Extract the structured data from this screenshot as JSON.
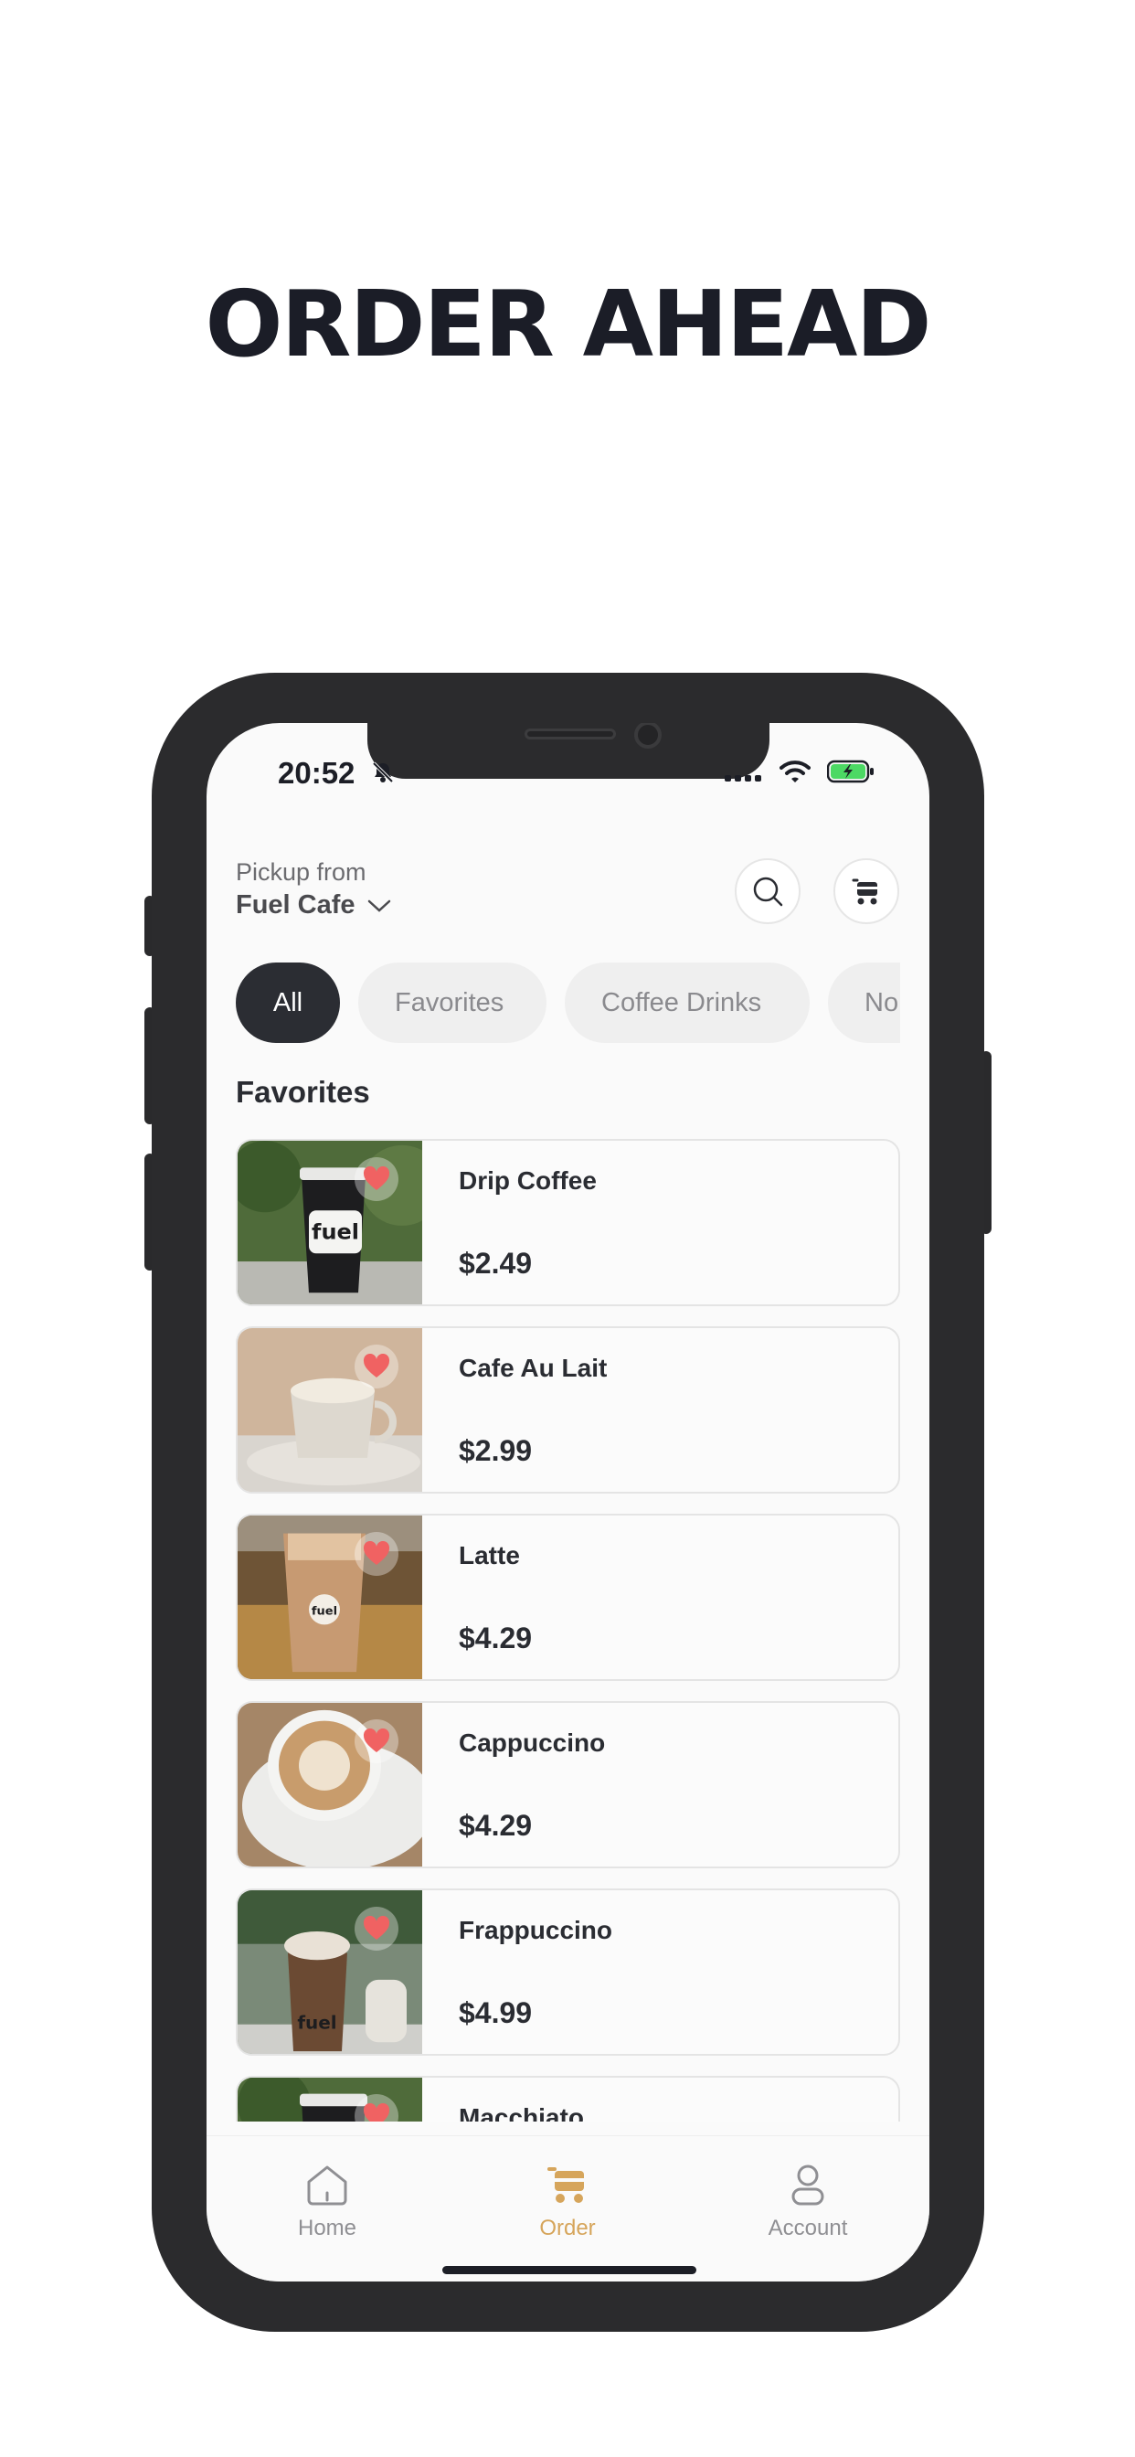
{
  "headline": "ORDER AHEAD",
  "status_bar": {
    "time": "20:52",
    "icons": [
      "bell-slash-icon",
      "cellular-signal-icon",
      "wifi-icon",
      "battery-charging-icon"
    ]
  },
  "header": {
    "pickup_label": "Pickup from",
    "location": "Fuel Cafe",
    "search_icon": "search-icon",
    "cart_icon": "cart-icon"
  },
  "categories": [
    {
      "label": "All",
      "selected": true
    },
    {
      "label": "Favorites",
      "selected": false
    },
    {
      "label": "Coffee Drinks",
      "selected": false
    },
    {
      "label": "No",
      "selected": false
    }
  ],
  "section_title": "Favorites",
  "menu_items": [
    {
      "name": "Drip Coffee",
      "price": "$2.49",
      "favorited": true
    },
    {
      "name": "Cafe Au Lait",
      "price": "$2.99",
      "favorited": true
    },
    {
      "name": "Latte",
      "price": "$4.29",
      "favorited": true
    },
    {
      "name": "Cappuccino",
      "price": "$4.29",
      "favorited": true
    },
    {
      "name": "Frappuccino",
      "price": "$4.99",
      "favorited": true
    },
    {
      "name": "Macchiato",
      "price": "",
      "favorited": true
    }
  ],
  "tab_bar": {
    "tabs": [
      {
        "label": "Home",
        "icon": "home-icon",
        "active": false
      },
      {
        "label": "Order",
        "icon": "cart-icon",
        "active": true
      },
      {
        "label": "Account",
        "icon": "user-icon",
        "active": false
      }
    ]
  },
  "colors": {
    "accent": "#d6a55b",
    "heart": "#f06262",
    "dark": "#2b2d33"
  }
}
